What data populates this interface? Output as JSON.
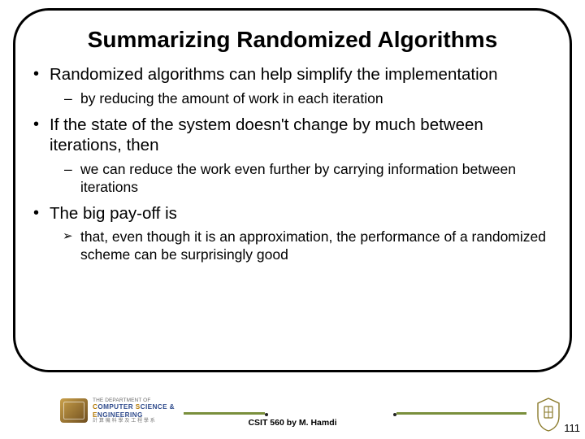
{
  "title": "Summarizing Randomized Algorithms",
  "bullets": [
    {
      "level": 1,
      "style": "dot",
      "text": "Randomized algorithms can help simplify the implementation"
    },
    {
      "level": 2,
      "style": "dash",
      "text": "by reducing the amount of work in each iteration"
    },
    {
      "level": 1,
      "style": "dot",
      "text": "If the state of the system doesn't change by much between iterations, then"
    },
    {
      "level": 2,
      "style": "dash",
      "text": "we can reduce the work even further by carrying information between iterations"
    },
    {
      "level": 1,
      "style": "dot",
      "text": "The big pay-off is"
    },
    {
      "level": 2,
      "style": "arrow",
      "text": "that, even though it is an approximation, the performance of a randomized scheme can be surprisingly good"
    }
  ],
  "footer": {
    "dept_small": "THE DEPARTMENT OF",
    "dept_line1a": "C",
    "dept_line1b": "OMPUTER ",
    "dept_line1c": "S",
    "dept_line1d": "CIENCE &",
    "dept_line2a": "E",
    "dept_line2b": "NGINEERING",
    "dept_sub": "計 算 機 科 學 及 工 程 學 系",
    "center": "CSIT 560 by M. Hamdi",
    "page": "111"
  }
}
